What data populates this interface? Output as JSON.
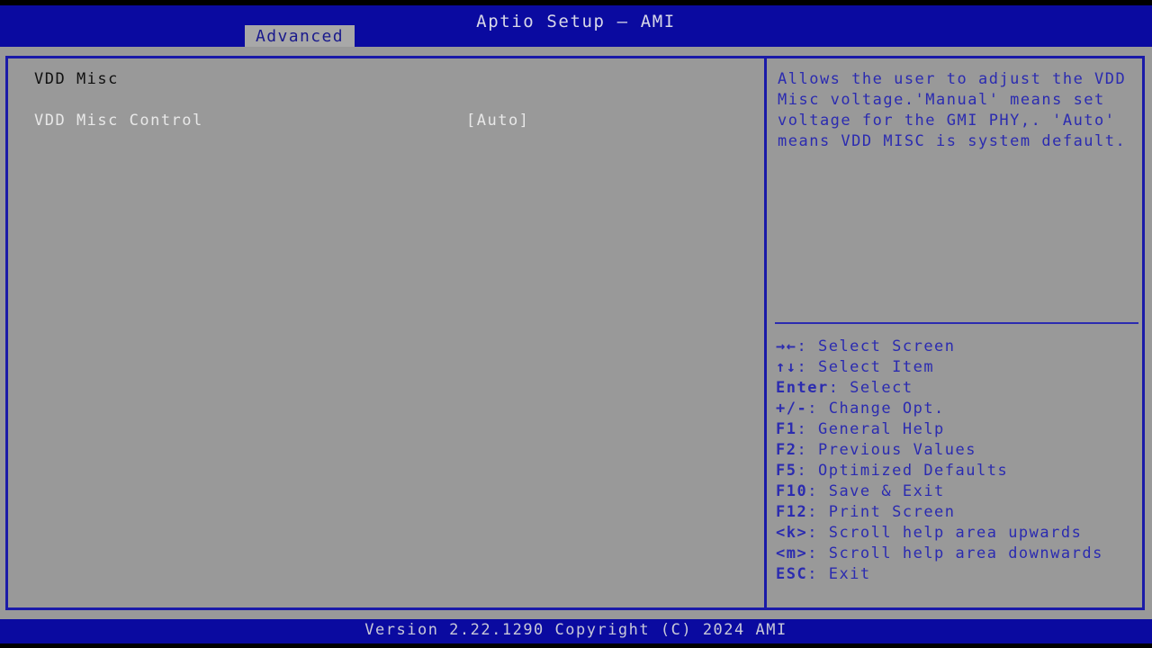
{
  "header": {
    "title": "Aptio Setup – AMI",
    "tabs": [
      {
        "label": "Advanced",
        "active": true
      }
    ]
  },
  "main": {
    "group_title": "VDD Misc",
    "options": [
      {
        "label": "VDD Misc Control",
        "value": "[Auto]",
        "selected": true
      }
    ]
  },
  "help": {
    "text": "Allows the user to adjust the VDD Misc voltage.'Manual' means set voltage for the GMI PHY,. 'Auto' means VDD MISC is system default."
  },
  "legend": {
    "rows": [
      {
        "key": "→←",
        "sep": ": ",
        "action": "Select Screen",
        "icon": "arrow-right-left-icon"
      },
      {
        "key": "↑↓",
        "sep": ": ",
        "action": "Select Item",
        "icon": "arrow-up-down-icon"
      },
      {
        "key": "Enter",
        "sep": ": ",
        "action": "Select",
        "icon": "enter-key-icon"
      },
      {
        "key": "+/-",
        "sep": ": ",
        "action": "Change Opt.",
        "icon": "plus-minus-key-icon"
      },
      {
        "key": "F1",
        "sep": ": ",
        "action": "General Help",
        "icon": "f1-key-icon"
      },
      {
        "key": "F2",
        "sep": ": ",
        "action": "Previous Values",
        "icon": "f2-key-icon"
      },
      {
        "key": "F5",
        "sep": ": ",
        "action": "Optimized Defaults",
        "icon": "f5-key-icon"
      },
      {
        "key": "F10",
        "sep": ": ",
        "action": "Save & Exit",
        "icon": "f10-key-icon"
      },
      {
        "key": "F12",
        "sep": ": ",
        "action": "Print Screen",
        "icon": "f12-key-icon"
      },
      {
        "key": "<k>",
        "sep": ": ",
        "action": "Scroll help area upwards",
        "icon": "k-key-icon"
      },
      {
        "key": "<m>",
        "sep": ": ",
        "action": "Scroll help area downwards",
        "icon": "m-key-icon"
      },
      {
        "key": "ESC",
        "sep": ": ",
        "action": "Exit",
        "icon": "esc-key-icon"
      }
    ]
  },
  "footer": {
    "version_text": "Version 2.22.1290 Copyright (C) 2024 AMI"
  },
  "colors": {
    "header_blue": "#0a0aa0",
    "panel_gray": "#999999",
    "frame_blue": "#1a1aa8",
    "help_blue": "#2b2bb0",
    "option_white": "#e8e8e8",
    "group_black": "#101010",
    "tab_gray": "#a8a8a8"
  }
}
